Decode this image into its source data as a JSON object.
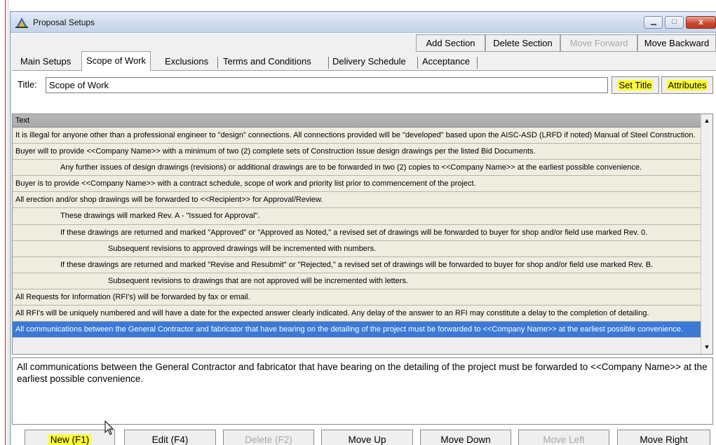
{
  "window": {
    "title": "Proposal Setups",
    "close_glyph": "x",
    "max_glyph": "□"
  },
  "section_toolbar": {
    "add_section": "Add Section",
    "delete_section": "Delete Section",
    "move_forward": "Move Forward",
    "move_backward": "Move Backward"
  },
  "tabs": [
    {
      "label": "Main Setups"
    },
    {
      "label": "Scope of Work",
      "active": true
    },
    {
      "label": "Exclusions"
    },
    {
      "label": "Terms and Conditions"
    },
    {
      "label": "Delivery Schedule"
    },
    {
      "label": "Acceptance"
    }
  ],
  "title_row": {
    "label": "Title:",
    "value": "Scope of Work",
    "set_title": "Set Title",
    "attributes": "Attributes"
  },
  "grid": {
    "header": "Text",
    "rows": [
      {
        "level": 0,
        "text": "It is illegal for anyone other than a professional engineer to \"design\" connections.  All connections provided will be \"developed\" based upon the AISC-ASD (LRFD if noted) Manual of Steel Construction."
      },
      {
        "level": 0,
        "text": "Buyer will to provide <<Company Name>> with a minimum of two (2) complete sets of Construction Issue design drawings per the listed Bid Documents."
      },
      {
        "level": 1,
        "text": "Any further issues of design drawings (revisions) or additional drawings are to be forwarded in two (2) copies to <<Company Name>> at the earliest possible convenience."
      },
      {
        "level": 0,
        "text": "Buyer is to provide <<Company Name>> with a contract schedule, scope of work and priority list prior to commencement of the project."
      },
      {
        "level": 0,
        "text": "All erection and/or shop drawings will be forwarded to <<Recipient>> for Approval/Review."
      },
      {
        "level": 1,
        "text": "These drawings will marked Rev. A - \"Issued for Approval\"."
      },
      {
        "level": 1,
        "text": "If these drawings are returned and marked \"Approved\" or \"Approved as Noted,\" a revised set of drawings will be forwarded to buyer for shop and/or field use marked Rev. 0."
      },
      {
        "level": 2,
        "text": "Subsequent revisions to approved drawings will be incremented with numbers."
      },
      {
        "level": 1,
        "text": "If these drawings are returned and marked \"Revise and Resubmit\" or \"Rejected,\" a revised set of drawings will be forwarded to buyer for shop and/or field use marked Rev. B."
      },
      {
        "level": 2,
        "text": "Subsequent revisions to drawings that are not approved will be incremented with letters."
      },
      {
        "level": 0,
        "text": "All Requests for Information (RFI's) will be forwarded by fax or email."
      },
      {
        "level": 0,
        "text": "All RFI's will be uniquely numbered and will have a date for the expected answer clearly indicated.  Any delay of the answer to an RFI may constitute a delay to the completion of detailing."
      },
      {
        "level": 0,
        "selected": true,
        "text": "All communications between the General Contractor and fabricator that have bearing on the detailing of the project must be forwarded to <<Company Name>> at the earliest possible convenience."
      }
    ]
  },
  "preview_text": "All communications between the General Contractor and fabricator that have bearing on the detailing of the project must be forwarded to <<Company Name>> at the earliest possible convenience.",
  "bottom_buttons": {
    "new": "New (F1)",
    "edit": "Edit (F4)",
    "delete": "Delete (F2)",
    "move_up": "Move Up",
    "move_down": "Move Down",
    "move_left": "Move Left",
    "move_right": "Move Right"
  },
  "colors": {
    "highlight": "#ffff33",
    "selected_row": "#3b79d6",
    "row_bg": "#efece0"
  },
  "icons": {
    "app": "proposal-app-icon",
    "scroll_up": "scroll-up-arrow-icon",
    "scroll_down": "scroll-down-arrow-icon",
    "cursor": "mouse-cursor-icon"
  }
}
